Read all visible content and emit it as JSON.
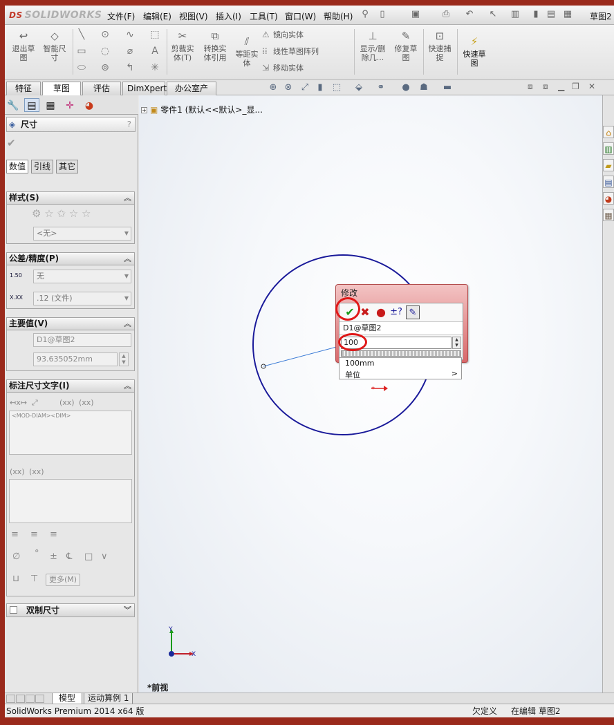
{
  "app": {
    "brand": "SOLIDWORKS",
    "doc_title": "草图2"
  },
  "menu": [
    "文件(F)",
    "编辑(E)",
    "视图(V)",
    "插入(I)",
    "工具(T)",
    "窗口(W)",
    "帮助(H)"
  ],
  "ribbon": {
    "exit_sketch": "退出草图",
    "smart_dim": "智能尺寸",
    "trim": "剪裁实体(T)",
    "convert": "转换实体引用",
    "offset": "等距实体",
    "mirror": "镜向实体",
    "linear_pattern": "线性草图阵列",
    "move": "移动实体",
    "show_delete": "显示/删除几...",
    "repair": "修复草图",
    "quick_snap": "快速捕捉",
    "rapid_sketch": "快速草图"
  },
  "cmd_tabs": [
    "特征",
    "草图",
    "评估",
    "DimXpert",
    "办公室产品"
  ],
  "pm": {
    "title": "尺寸",
    "tabs": [
      "数值",
      "引线",
      "其它"
    ],
    "style": {
      "header": "样式(S)",
      "combo": "<无>"
    },
    "tolerance": {
      "header": "公差/精度(P)",
      "tol_icon": "1.50",
      "tol_value": "无",
      "prec_icon": "X.XX",
      "prec_value": ".12 (文件)"
    },
    "primary": {
      "header": "主要值(V)",
      "name": "D1@草图2",
      "value": "93.635052mm"
    },
    "dimtext": {
      "header": "标注尺寸文字(I)",
      "xx": "(xx)",
      "text": "<MOD-DIAM><DIM>",
      "more": "更多(M)"
    },
    "dual": "双制尺寸"
  },
  "gfx": {
    "tree_item": "零件1  (默认<<默认>_显...",
    "view_label": "*前视"
  },
  "modify": {
    "title": "修改",
    "name": "D1@草图2",
    "value": "100",
    "drop1": "100mm",
    "drop2": "单位"
  },
  "bottom_tabs": [
    "模型",
    "运动算例 1"
  ],
  "status": {
    "left": "SolidWorks Premium 2014 x64 版",
    "mid": "欠定义",
    "right": "在编辑 草图2"
  },
  "colors": {
    "sketch_circle": "#1a1a9a",
    "accept": "#1a9a1a",
    "highlight_ring": "#e01818"
  }
}
